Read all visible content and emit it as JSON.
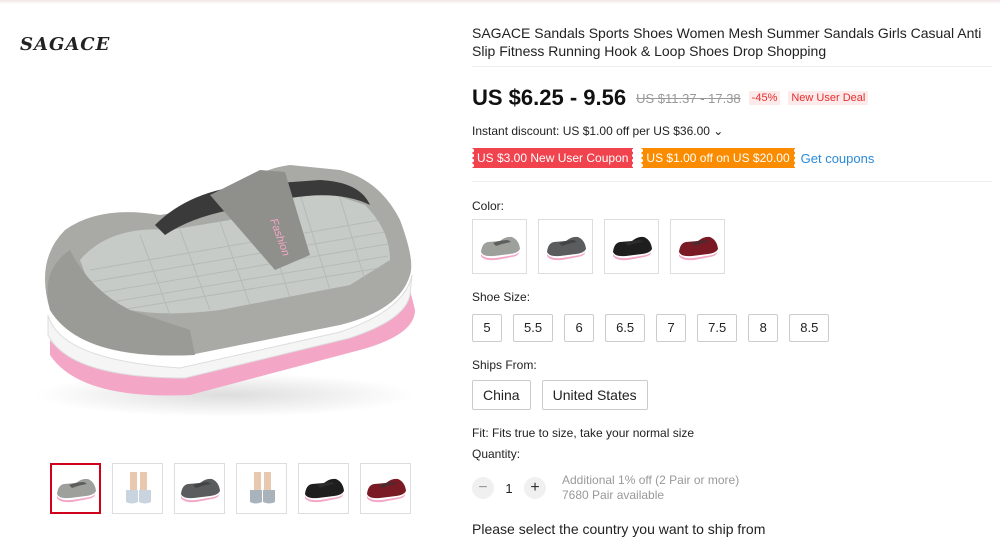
{
  "brand": "SAGACE",
  "product": {
    "title": "SAGACE Sandals Sports Shoes Women Mesh Summer Sandals Girls Casual Anti Slip Fitness Running Hook & Loop Shoes Drop Shopping",
    "price": "US $6.25 - 9.56",
    "old_price": "US $11.37 - 17.38",
    "discount": "-45%",
    "new_user_deal": "New User Deal",
    "instant_discount": "Instant discount: US $1.00 off per US $36.00 ⌄",
    "coupons": [
      {
        "label": "US $3.00 New User Coupon",
        "color": "#f0434e"
      },
      {
        "label": "US $1.00 off on US $20.00",
        "color": "#fb8c00"
      }
    ],
    "get_coupons": "Get coupons"
  },
  "color": {
    "label": "Color:",
    "options": [
      {
        "name": "gray",
        "hex": "#9ea09c"
      },
      {
        "name": "dark-gray",
        "hex": "#5a5c5e"
      },
      {
        "name": "black",
        "hex": "#1e1e1e"
      },
      {
        "name": "wine-red",
        "hex": "#7a1a24"
      }
    ]
  },
  "shoe_size": {
    "label": "Shoe Size:",
    "options": [
      "5",
      "5.5",
      "6",
      "6.5",
      "7",
      "7.5",
      "8",
      "8.5"
    ]
  },
  "ships_from": {
    "label": "Ships From:",
    "options": [
      "China",
      "United States"
    ]
  },
  "fit": "Fit: Fits true to size, take your normal size",
  "quantity": {
    "label": "Quantity:",
    "minus": "−",
    "value": "1",
    "plus": "+",
    "additional": "Additional 1% off (2 Pair or more)",
    "available": "7680 Pair available"
  },
  "ship_note": "Please select the country you want to ship from",
  "thumbnails": [
    {
      "kind": "shoe",
      "hex": "#9ea09c",
      "active": true
    },
    {
      "kind": "worn",
      "hex": "#c9d4de"
    },
    {
      "kind": "shoe",
      "hex": "#5a5c5e"
    },
    {
      "kind": "worn",
      "hex": "#a9b3bb"
    },
    {
      "kind": "shoe",
      "hex": "#1e1e1e"
    },
    {
      "kind": "shoe",
      "hex": "#7a1a24"
    }
  ]
}
